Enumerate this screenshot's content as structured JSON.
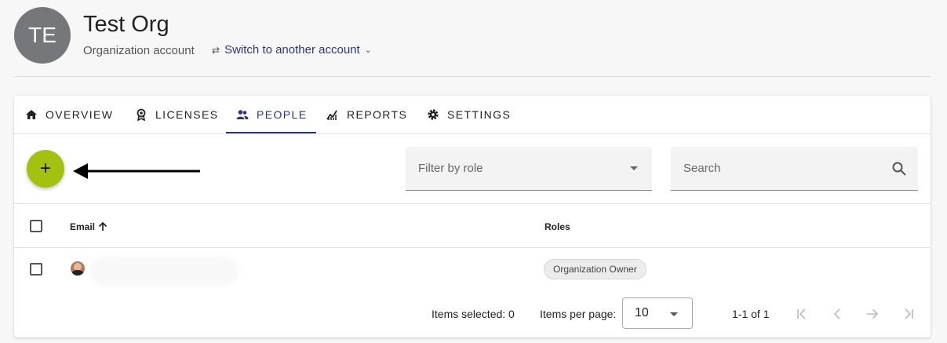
{
  "account": {
    "avatar_initials": "TE",
    "name": "Test Org",
    "type": "Organization account",
    "switch_label": "Switch to another account"
  },
  "tabs": [
    {
      "label": "OVERVIEW",
      "icon": "home-icon"
    },
    {
      "label": "LICENSES",
      "icon": "badge-icon"
    },
    {
      "label": "PEOPLE",
      "icon": "people-icon",
      "active": true
    },
    {
      "label": "REPORTS",
      "icon": "chart-icon"
    },
    {
      "label": "SETTINGS",
      "icon": "gear-icon"
    }
  ],
  "toolbar": {
    "add_label": "+",
    "filter_placeholder": "Filter by role",
    "search_placeholder": "Search"
  },
  "table": {
    "columns": {
      "email": "Email",
      "roles": "Roles"
    },
    "rows": [
      {
        "role": "Organization Owner"
      }
    ]
  },
  "pager": {
    "selected_label": "Items selected: 0",
    "per_page_label": "Items per page:",
    "per_page_value": "10",
    "range": "1-1 of 1"
  },
  "colors": {
    "accent": "#2a3676",
    "fab": "#a3c10f",
    "avatar": "#76777a"
  }
}
